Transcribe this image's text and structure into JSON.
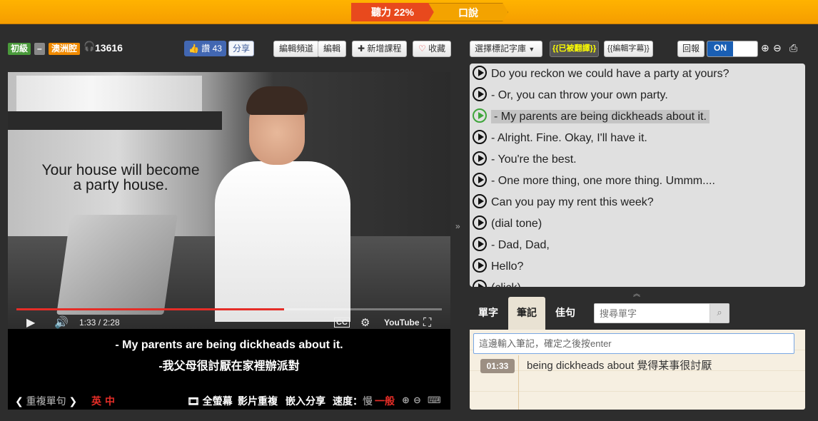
{
  "steps": {
    "active": "聽力 22%",
    "next": "口說"
  },
  "header": {
    "level_badge": "初級",
    "dash_badge": "–",
    "accent_badge": "澳洲腔",
    "views": "13616",
    "like_label": "讚 43",
    "share_label": "分享",
    "edit_channel": "編輯頻道",
    "edit": "編輯",
    "add_course": "新增課程",
    "collect": "收藏"
  },
  "video": {
    "overlay_line1": "Your house will become",
    "overlay_line2": "a party house.",
    "time": "1:33 / 2:28",
    "progress_fraction": 0.63,
    "subtitle_en": "- My parents are being dickheads about it.",
    "subtitle_zh": "-我父母很討厭在家裡辦派對",
    "repeat_label": "重複單句",
    "lang_en": "英",
    "lang_zh": "中",
    "fullscreen_label": "全螢幕",
    "replay_label": "影片重複",
    "embed_label": "嵌入分享",
    "speed_label": "速度：",
    "speed_slow": "慢",
    "speed_normal": "一般"
  },
  "right": {
    "dict_select": "選擇標記字庫",
    "translated_tag": "{{已被翻譯}}",
    "edit_subs": "{{編輯字幕}}",
    "rewind": "回報",
    "toggle_label": "ON"
  },
  "subtitles": [
    {
      "text": "Do you reckon we could have a party at yours?",
      "current": false
    },
    {
      "text": "- Or, you can throw your own party.",
      "current": false
    },
    {
      "text": "- My parents are being dickheads about it.",
      "current": true
    },
    {
      "text": "- Alright. Fine. Okay, I'll have it.",
      "current": false
    },
    {
      "text": "- You're the best.",
      "current": false
    },
    {
      "text": "- One more thing, one more thing. Ummm....",
      "current": false
    },
    {
      "text": "Can you pay my rent this week?",
      "current": false
    },
    {
      "text": "(dial tone)",
      "current": false
    },
    {
      "text": "- Dad, Dad,",
      "current": false
    },
    {
      "text": "Hello?",
      "current": false
    },
    {
      "text": "(click)",
      "current": false
    }
  ],
  "tabs": {
    "words": "單字",
    "notes": "筆記",
    "sentences": "佳句"
  },
  "search": {
    "placeholder": "搜尋單字"
  },
  "notes": {
    "input_placeholder": "這邊輸入筆記，確定之後按enter",
    "items": [
      {
        "time": "01:33",
        "text": "being dickheads about 覺得某事很討厭"
      }
    ]
  },
  "colors": {
    "topbar": "#f5a100",
    "active_step": "#e8491d",
    "toggle_on": "#1a5fb4",
    "current_play": "#3fa53b",
    "red_label": "#e52d27"
  }
}
